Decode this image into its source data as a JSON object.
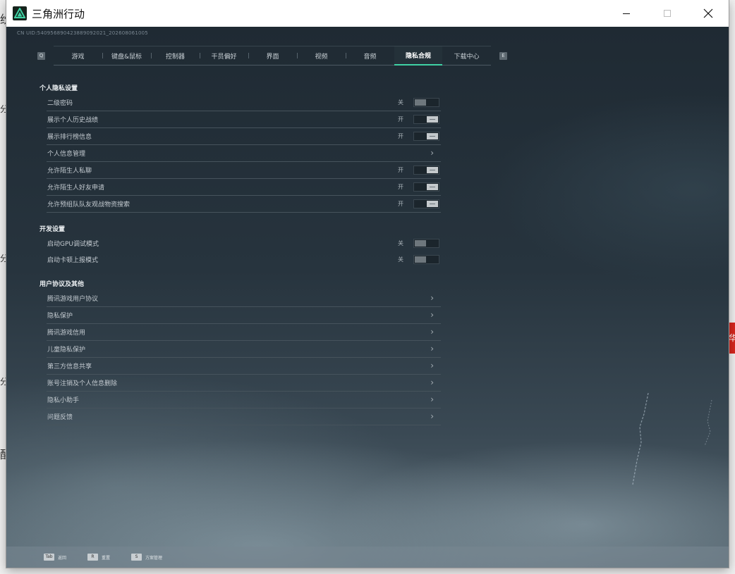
{
  "window": {
    "title": "三角洲行动",
    "uid_text": "CN UID:540956890423889092021_202608061005"
  },
  "tabs": {
    "prev_key": "Q",
    "next_key": "E",
    "items": [
      {
        "label": "游戏",
        "active": false
      },
      {
        "label": "键盘&鼠标",
        "active": false
      },
      {
        "label": "控制器",
        "active": false
      },
      {
        "label": "干员偏好",
        "active": false
      },
      {
        "label": "界面",
        "active": false
      },
      {
        "label": "视频",
        "active": false
      },
      {
        "label": "音频",
        "active": false
      },
      {
        "label": "隐私合规",
        "active": true
      },
      {
        "label": "下载中心",
        "active": false
      }
    ]
  },
  "sections": {
    "privacy": {
      "title": "个人隐私设置",
      "rows": [
        {
          "label": "二级密码",
          "state": "关"
        },
        {
          "label": "展示个人历史战绩",
          "state": "开"
        },
        {
          "label": "展示排行榜信息",
          "state": "开"
        },
        {
          "label": "个人信息管理"
        },
        {
          "label": "允许陌生人私聊",
          "state": "开"
        },
        {
          "label": "允许陌生人好友申请",
          "state": "开"
        },
        {
          "label": "允许预组队队友观战物资搜索",
          "state": "开"
        }
      ]
    },
    "dev": {
      "title": "开发设置",
      "rows": [
        {
          "label": "启动GPU调试模式",
          "state": "关"
        },
        {
          "label": "启动卡顿上报模式",
          "state": "关"
        }
      ]
    },
    "agreements": {
      "title": "用户协议及其他",
      "rows": [
        {
          "label": "腾讯游戏用户协议"
        },
        {
          "label": "隐私保护"
        },
        {
          "label": "腾讯游戏信用"
        },
        {
          "label": "儿童隐私保护"
        },
        {
          "label": "第三方信息共享"
        },
        {
          "label": "账号注销及个人信息删除"
        },
        {
          "label": "隐私小助手"
        },
        {
          "label": "问题反馈"
        }
      ]
    }
  },
  "footer": {
    "hints": [
      {
        "key": "Tab",
        "text": "返回"
      },
      {
        "key": "R",
        "text": "重置"
      },
      {
        "key": "S",
        "text": "方案管理"
      }
    ]
  },
  "colors": {
    "accent": "#3fd2a4",
    "background": "#1f2a33"
  }
}
